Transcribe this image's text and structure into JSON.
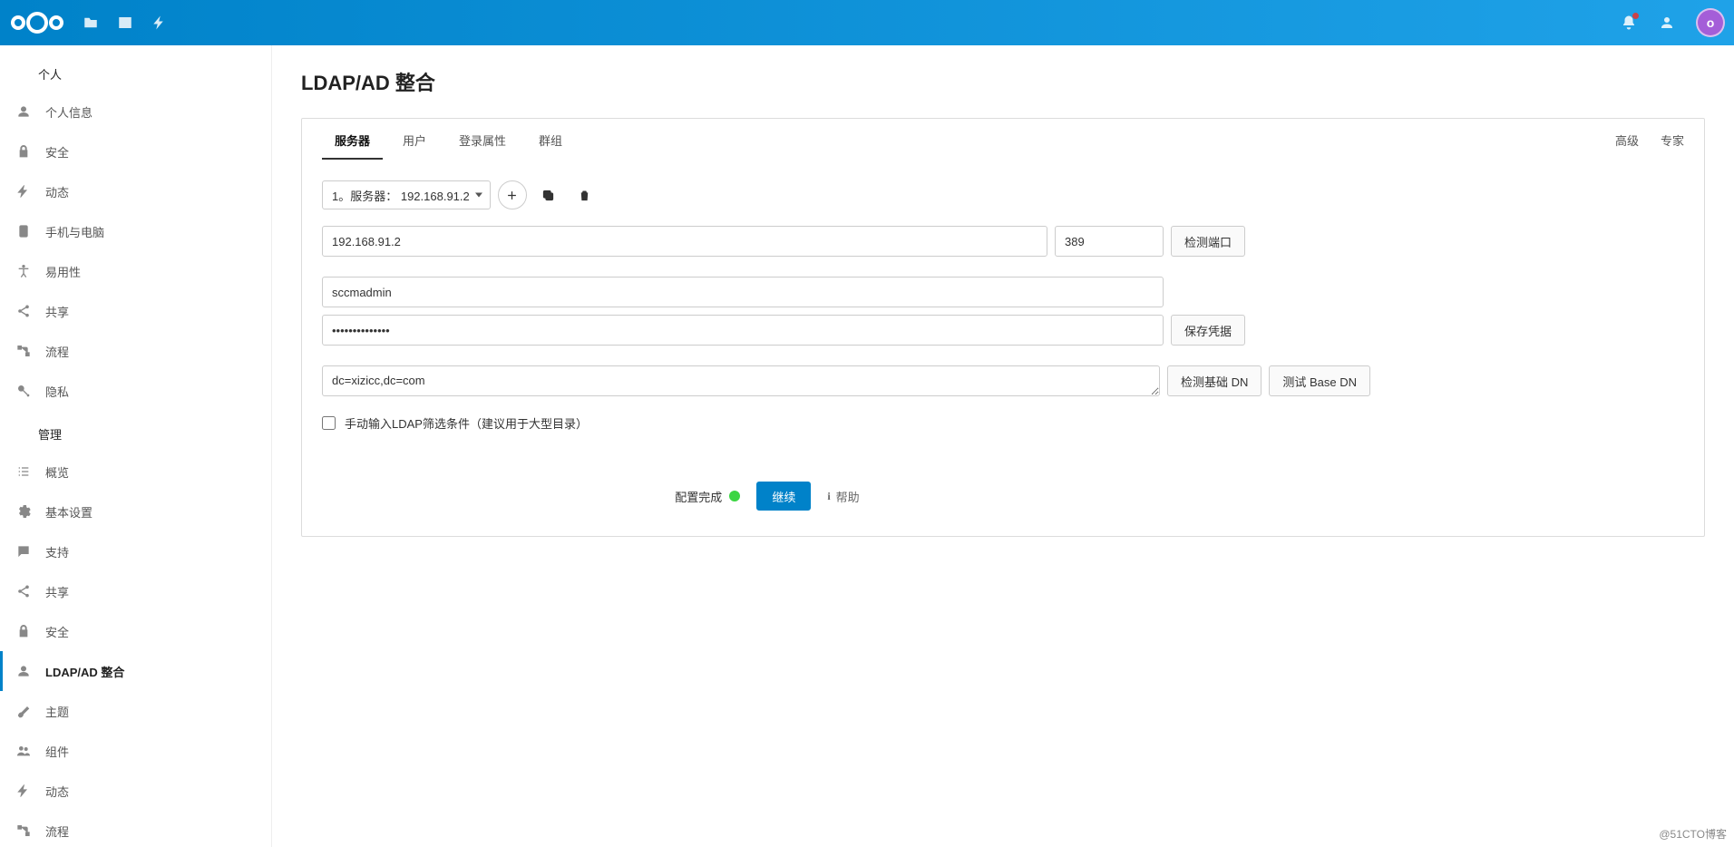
{
  "header": {
    "avatar_initial": "o"
  },
  "sidebar": {
    "personal": {
      "title": "个人",
      "items": [
        {
          "label": "个人信息"
        },
        {
          "label": "安全"
        },
        {
          "label": "动态"
        },
        {
          "label": "手机与电脑"
        },
        {
          "label": "易用性"
        },
        {
          "label": "共享"
        },
        {
          "label": "流程"
        },
        {
          "label": "隐私"
        }
      ]
    },
    "admin": {
      "title": "管理",
      "items": [
        {
          "label": "概览"
        },
        {
          "label": "基本设置"
        },
        {
          "label": "支持"
        },
        {
          "label": "共享"
        },
        {
          "label": "安全"
        },
        {
          "label": "LDAP/AD 整合"
        },
        {
          "label": "主题"
        },
        {
          "label": "组件"
        },
        {
          "label": "动态"
        },
        {
          "label": "流程"
        }
      ]
    }
  },
  "main": {
    "title": "LDAP/AD 整合",
    "tabs": {
      "server": "服务器",
      "users": "用户",
      "login": "登录属性",
      "groups": "群组"
    },
    "right_links": {
      "advanced": "高级",
      "expert": "专家"
    },
    "server_select": "1。服务器：  192.168.91.2",
    "host": "192.168.91.2",
    "port": "389",
    "btn_detect_port": "检测端口",
    "user_dn": "sccmadmin",
    "password": "••••••••••••••",
    "btn_save_cred": "保存凭据",
    "base_dn": "dc=xizicc,dc=com",
    "btn_detect_base": "检测基础 DN",
    "btn_test_base": "测试 Base DN",
    "checkbox_label": "手动输入LDAP筛选条件（建议用于大型目录）",
    "status": "配置完成",
    "btn_continue": "继续",
    "help_label": "帮助"
  },
  "watermark": "@51CTO博客"
}
